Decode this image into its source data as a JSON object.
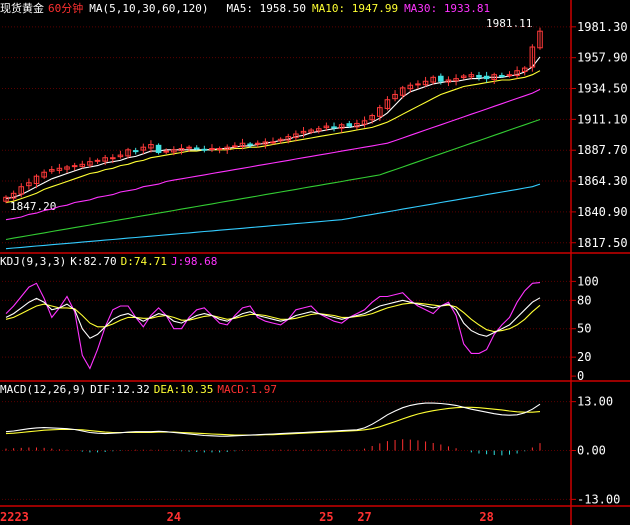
{
  "colors": {
    "background": "#000000",
    "frame": "#cc0000",
    "grid": "#5a0000",
    "up": "#ff3a3a",
    "down": "#40e0e0",
    "ma5": "#ffffff",
    "ma10": "#ffff33",
    "ma30": "#ff33ff",
    "ma60": "#33cc33",
    "ma120": "#33ccff",
    "k": "#ffffff",
    "d": "#ffff33",
    "j": "#ff33ff",
    "dif": "#ffffff",
    "dea": "#ffff33",
    "macd_hist_pos": "#ff3030",
    "macd_hist_neg": "#30e0e0"
  },
  "chart_data": [
    {
      "type": "candlestick",
      "title": "现货黄金",
      "period": "60分钟",
      "ma_header": "MA(5,10,30,60,120)",
      "ma_values": [
        {
          "name": "MA5",
          "value": "1958.50"
        },
        {
          "name": "MA10",
          "value": "1947.99"
        },
        {
          "name": "MA30",
          "value": "1933.81"
        }
      ],
      "ylim": [
        1812,
        1988
      ],
      "y_ticks": [
        "1981.30",
        "1957.90",
        "1934.50",
        "1911.10",
        "1887.70",
        "1864.30",
        "1840.90",
        "1817.50"
      ],
      "annotations": {
        "high": "1981.11",
        "low": "1847.20"
      },
      "x_labels": [
        {
          "label": "2223",
          "bar": 0
        },
        {
          "label": "24",
          "bar": 22
        },
        {
          "label": "25",
          "bar": 42
        },
        {
          "label": "27",
          "bar": 47
        },
        {
          "label": "28",
          "bar": 63
        }
      ],
      "close": [
        1852,
        1855,
        1860,
        1863,
        1868,
        1871,
        1873,
        1874,
        1875,
        1876,
        1877,
        1879,
        1880,
        1882,
        1882,
        1884,
        1888,
        1887,
        1890,
        1892,
        1886,
        1887,
        1888,
        1889,
        1890,
        1889,
        1888,
        1889,
        1889,
        1890,
        1891,
        1893,
        1892,
        1893,
        1894,
        1894,
        1896,
        1898,
        1900,
        1902,
        1903,
        1904,
        1906,
        1905,
        1907,
        1906,
        1908,
        1910,
        1914,
        1920,
        1926,
        1930,
        1935,
        1937,
        1938,
        1940,
        1943,
        1940,
        1941,
        1942,
        1944,
        1945,
        1943,
        1942,
        1945,
        1944,
        1945,
        1948,
        1950,
        1966,
        1978
      ],
      "ma5": [
        1851,
        1852,
        1854,
        1857,
        1860,
        1863,
        1866,
        1868,
        1870,
        1872,
        1874,
        1875,
        1876,
        1878,
        1879,
        1880,
        1882,
        1883,
        1885,
        1887,
        1887,
        1888,
        1888,
        1888,
        1888,
        1888,
        1888,
        1888,
        1889,
        1889,
        1890,
        1891,
        1891,
        1892,
        1893,
        1894,
        1895,
        1896,
        1898,
        1899,
        1901,
        1902,
        1903,
        1904,
        1905,
        1905,
        1906,
        1907,
        1909,
        1912,
        1916,
        1922,
        1928,
        1932,
        1934,
        1936,
        1938,
        1939,
        1940,
        1940,
        1941,
        1942,
        1942,
        1943,
        1943,
        1943,
        1944,
        1945,
        1947,
        1951,
        1958.5
      ],
      "ma10": [
        1848,
        1849,
        1851,
        1853,
        1855,
        1858,
        1860,
        1862,
        1864,
        1866,
        1868,
        1870,
        1871,
        1873,
        1874,
        1876,
        1877,
        1879,
        1880,
        1882,
        1883,
        1884,
        1885,
        1886,
        1887,
        1887,
        1888,
        1888,
        1888,
        1888,
        1889,
        1889,
        1890,
        1890,
        1891,
        1892,
        1893,
        1894,
        1895,
        1896,
        1897,
        1898,
        1899,
        1900,
        1901,
        1902,
        1903,
        1904,
        1905,
        1907,
        1909,
        1912,
        1915,
        1918,
        1921,
        1924,
        1927,
        1930,
        1932,
        1934,
        1936,
        1937,
        1938,
        1939,
        1940,
        1941,
        1941,
        1942,
        1943,
        1945,
        1947.99
      ],
      "ma30": [
        1835,
        1836,
        1837,
        1839,
        1840,
        1842,
        1843,
        1845,
        1846,
        1848,
        1849,
        1850,
        1852,
        1853,
        1854,
        1856,
        1857,
        1858,
        1860,
        1861,
        1862,
        1864,
        1865,
        1866,
        1867,
        1868,
        1869,
        1870,
        1871,
        1872,
        1873,
        1874,
        1875,
        1876,
        1877,
        1878,
        1879,
        1880,
        1881,
        1882,
        1883,
        1884,
        1885,
        1886,
        1887,
        1888,
        1889,
        1890,
        1891,
        1892,
        1893,
        1895,
        1897,
        1899,
        1901,
        1903,
        1905,
        1907,
        1909,
        1911,
        1913,
        1915,
        1917,
        1919,
        1921,
        1923,
        1925,
        1927,
        1929,
        1931,
        1933.81
      ],
      "ma60": [
        1820,
        1821,
        1822,
        1823,
        1824,
        1825,
        1826,
        1827,
        1828,
        1829,
        1830,
        1831,
        1832,
        1833,
        1834,
        1835,
        1836,
        1837,
        1838,
        1839,
        1840,
        1841,
        1842,
        1843,
        1844,
        1845,
        1846,
        1847,
        1848,
        1849,
        1850,
        1851,
        1852,
        1853,
        1854,
        1855,
        1856,
        1857,
        1858,
        1859,
        1860,
        1861,
        1862,
        1863,
        1864,
        1865,
        1866,
        1867,
        1868,
        1869,
        1871,
        1873,
        1875,
        1877,
        1879,
        1881,
        1883,
        1885,
        1887,
        1889,
        1891,
        1893,
        1895,
        1897,
        1899,
        1901,
        1903,
        1905,
        1907,
        1909,
        1911
      ],
      "ma120": [
        1813,
        1813.5,
        1814,
        1814.5,
        1815,
        1815.5,
        1816,
        1816.5,
        1817,
        1817.5,
        1818,
        1818.5,
        1819,
        1819.5,
        1820,
        1820.5,
        1821,
        1821.5,
        1822,
        1822.5,
        1823,
        1823.5,
        1824,
        1824.5,
        1825,
        1825.5,
        1826,
        1826.5,
        1827,
        1827.5,
        1828,
        1828.5,
        1829,
        1829.5,
        1830,
        1830.5,
        1831,
        1831.5,
        1832,
        1832.5,
        1833,
        1833.5,
        1834,
        1834.5,
        1835,
        1836,
        1837,
        1838,
        1839,
        1840,
        1841,
        1842,
        1843,
        1844,
        1845,
        1846,
        1847,
        1848,
        1849,
        1850,
        1851,
        1852,
        1853,
        1854,
        1855,
        1856,
        1857,
        1858,
        1859,
        1860,
        1862
      ]
    },
    {
      "type": "line",
      "title": "KDJ(9,3,3)",
      "values_header": [
        {
          "name": "K",
          "value": "82.70"
        },
        {
          "name": "D",
          "value": "74.71"
        },
        {
          "name": "J",
          "value": "98.68"
        }
      ],
      "ylim": [
        -2,
        112
      ],
      "y_ticks": [
        "100",
        "80",
        "50",
        "20",
        "0"
      ],
      "k": [
        62,
        66,
        72,
        78,
        82,
        78,
        70,
        72,
        76,
        70,
        50,
        40,
        44,
        52,
        60,
        64,
        66,
        62,
        58,
        62,
        66,
        64,
        58,
        56,
        60,
        64,
        66,
        64,
        60,
        58,
        62,
        66,
        68,
        64,
        62,
        60,
        58,
        60,
        64,
        66,
        68,
        66,
        64,
        62,
        60,
        62,
        64,
        66,
        70,
        74,
        76,
        78,
        80,
        78,
        76,
        74,
        72,
        74,
        76,
        70,
        56,
        48,
        44,
        42,
        46,
        50,
        54,
        62,
        70,
        78,
        82.7
      ],
      "d": [
        60,
        62,
        66,
        70,
        74,
        76,
        74,
        72,
        72,
        71,
        64,
        56,
        52,
        52,
        55,
        59,
        62,
        62,
        61,
        61,
        63,
        64,
        62,
        59,
        59,
        61,
        63,
        64,
        62,
        60,
        61,
        63,
        65,
        65,
        64,
        62,
        60,
        60,
        61,
        63,
        65,
        66,
        65,
        64,
        62,
        62,
        63,
        64,
        66,
        69,
        72,
        74,
        76,
        77,
        77,
        76,
        75,
        74,
        75,
        73,
        67,
        60,
        54,
        49,
        47,
        48,
        50,
        54,
        60,
        68,
        74.71
      ],
      "j": [
        66,
        74,
        84,
        94,
        98,
        82,
        62,
        72,
        84,
        68,
        22,
        8,
        28,
        52,
        70,
        74,
        74,
        62,
        52,
        64,
        72,
        64,
        50,
        50,
        62,
        70,
        72,
        64,
        56,
        54,
        64,
        72,
        74,
        62,
        58,
        56,
        54,
        60,
        70,
        72,
        74,
        66,
        62,
        58,
        56,
        62,
        66,
        70,
        78,
        84,
        84,
        86,
        88,
        80,
        74,
        70,
        66,
        74,
        78,
        64,
        34,
        24,
        24,
        28,
        44,
        54,
        62,
        78,
        90,
        98,
        98.68
      ]
    },
    {
      "type": "line",
      "title": "MACD(12,26,9)",
      "values_header": [
        {
          "name": "DIF",
          "value": "12.32"
        },
        {
          "name": "DEA",
          "value": "10.35"
        },
        {
          "name": "MACD",
          "value": "1.97"
        }
      ],
      "ylim": [
        -14.5,
        14.5
      ],
      "y_ticks": [
        "13.00",
        "0.00",
        "-13.00"
      ],
      "dif": [
        5,
        5.2,
        5.5,
        5.8,
        6,
        6.1,
        6,
        5.9,
        5.8,
        5.6,
        5.2,
        4.8,
        4.6,
        4.5,
        4.6,
        4.7,
        4.9,
        5,
        5,
        5,
        5.1,
        5,
        4.8,
        4.6,
        4.4,
        4.2,
        4,
        3.9,
        3.8,
        3.8,
        3.9,
        4,
        4.1,
        4.2,
        4.3,
        4.4,
        4.5,
        4.6,
        4.7,
        4.8,
        4.9,
        5,
        5.1,
        5.2,
        5.3,
        5.4,
        5.5,
        6,
        7,
        8.2,
        9.5,
        10.5,
        11.4,
        12,
        12.4,
        12.6,
        12.6,
        12.5,
        12.3,
        12,
        11.5,
        11,
        10.6,
        10.2,
        9.8,
        9.5,
        9.4,
        9.5,
        10,
        11,
        12.32
      ],
      "dea": [
        4.5,
        4.6,
        4.8,
        5,
        5.2,
        5.4,
        5.5,
        5.6,
        5.6,
        5.6,
        5.5,
        5.3,
        5.1,
        4.9,
        4.8,
        4.8,
        4.8,
        4.8,
        4.8,
        4.8,
        4.9,
        4.9,
        4.9,
        4.8,
        4.7,
        4.6,
        4.5,
        4.4,
        4.3,
        4.2,
        4.1,
        4.1,
        4.1,
        4.1,
        4.2,
        4.2,
        4.3,
        4.4,
        4.5,
        4.6,
        4.7,
        4.8,
        4.9,
        5,
        5.1,
        5.2,
        5.3,
        5.5,
        5.8,
        6.3,
        7,
        7.7,
        8.4,
        9.1,
        9.7,
        10.2,
        10.6,
        10.9,
        11.2,
        11.4,
        11.5,
        11.5,
        11.4,
        11.2,
        11,
        10.8,
        10.5,
        10.3,
        10.2,
        10.2,
        10.35
      ],
      "macd": [
        0.5,
        0.6,
        0.7,
        0.8,
        0.8,
        0.7,
        0.5,
        0.3,
        0.2,
        0,
        -0.3,
        -0.5,
        -0.5,
        -0.4,
        -0.2,
        -0.1,
        0.1,
        0.2,
        0.2,
        0.2,
        0.2,
        0.1,
        -0.1,
        -0.2,
        -0.3,
        -0.4,
        -0.5,
        -0.5,
        -0.5,
        -0.4,
        -0.2,
        -0.1,
        0,
        0.1,
        0.1,
        0.2,
        0.2,
        0.2,
        0.2,
        0.2,
        0.2,
        0.2,
        0.2,
        0.2,
        0.2,
        0.2,
        0.2,
        0.5,
        1.2,
        1.9,
        2.5,
        2.8,
        3,
        2.9,
        2.7,
        2.4,
        2,
        1.6,
        1.1,
        0.6,
        0,
        -0.5,
        -0.8,
        -1,
        -1.2,
        -1.3,
        -1.1,
        -0.8,
        -0.2,
        0.8,
        1.97
      ]
    }
  ]
}
